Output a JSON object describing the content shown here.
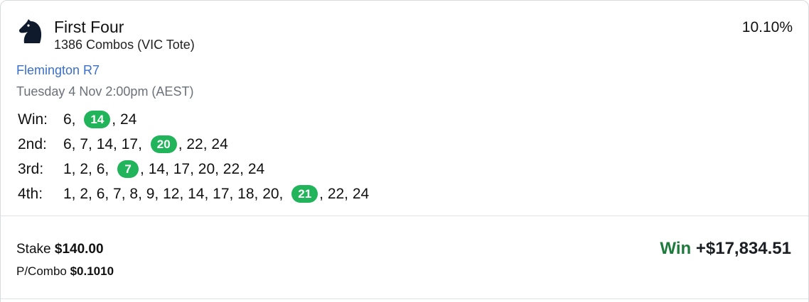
{
  "bet": {
    "title": "First Four",
    "subtitle": "1386 Combos (VIC Tote)",
    "percent": "10.10%",
    "meeting": "Flemington R7",
    "datetime": "Tuesday 4 Nov 2:00pm (AEST)",
    "logo_icon": "horse-head-icon"
  },
  "selections": [
    {
      "label": "Win:",
      "before": "6, ",
      "winner": "14",
      "after": ", 24"
    },
    {
      "label": "2nd:",
      "before": "6, 7, 14, 17, ",
      "winner": "20",
      "after": ", 22, 24"
    },
    {
      "label": "3rd:",
      "before": "1, 2, 6, ",
      "winner": "7",
      "after": ", 14, 17, 20, 22, 24"
    },
    {
      "label": "4th:",
      "before": "1, 2, 6, 7, 8, 9, 12, 14, 17, 18, 20, ",
      "winner": "21",
      "after": ", 22, 24"
    }
  ],
  "footer": {
    "stake_label": "Stake ",
    "stake_value": "$140.00",
    "combo_label": "P/Combo ",
    "combo_value": "$0.1010",
    "result_word": "Win",
    "result_amount": " +$17,834.51"
  },
  "colors": {
    "winner_pill": "#22b45a",
    "link": "#3a6fc9",
    "win_text": "#1e7b3d"
  }
}
